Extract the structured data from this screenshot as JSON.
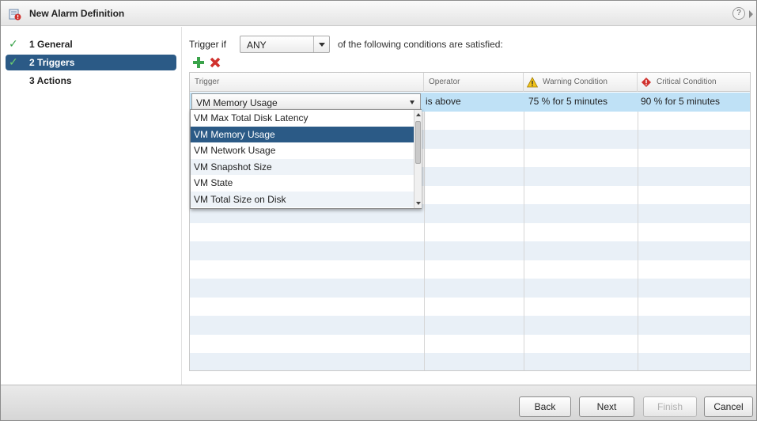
{
  "window": {
    "title": "New Alarm Definition",
    "help_glyph": "?"
  },
  "steps": [
    {
      "number": "1",
      "label": "General",
      "done": true
    },
    {
      "number": "2",
      "label": "Triggers",
      "done": true,
      "active": true
    },
    {
      "number": "3",
      "label": "Actions",
      "done": false
    }
  ],
  "trigger_rule": {
    "prefix": "Trigger if",
    "selected": "ANY",
    "suffix": "of the following conditions are satisfied:"
  },
  "table": {
    "headers": {
      "trigger": "Trigger",
      "operator": "Operator",
      "warning": "Warning Condition",
      "critical": "Critical Condition"
    },
    "rows": [
      {
        "trigger": "VM Memory Usage",
        "operator": "is above",
        "warning": "75 % for 5 minutes",
        "critical": "90 % for 5 minutes"
      }
    ]
  },
  "dropdown": {
    "options": [
      "VM Max Total Disk Latency",
      "VM Memory Usage",
      "VM Network Usage",
      "VM Snapshot Size",
      "VM State",
      "VM Total Size on Disk"
    ],
    "highlighted": "VM Memory Usage"
  },
  "footer": {
    "back": "Back",
    "next": "Next",
    "finish": "Finish",
    "cancel": "Cancel"
  },
  "colors": {
    "accent": "#2b5a86",
    "selected_row": "#bfe1f6",
    "check": "#3aa34a",
    "add": "#3aa34a",
    "remove": "#d0312d"
  }
}
